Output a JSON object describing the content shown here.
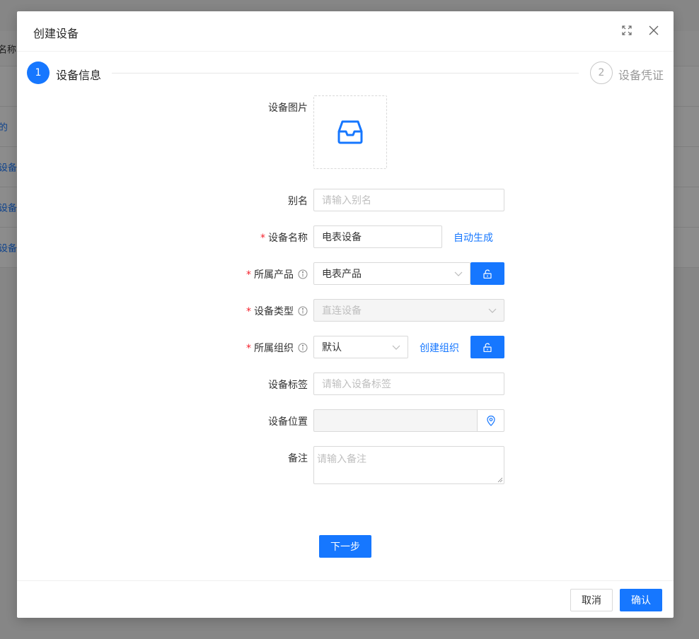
{
  "background": {
    "table_header": "名称",
    "rows": [
      "的",
      "设备",
      "设备",
      "设备"
    ]
  },
  "modal": {
    "title": "创建设备",
    "icons": {
      "expand": "fullscreen-icon",
      "close": "close-icon"
    }
  },
  "steps": [
    {
      "number": "1",
      "label": "设备信息",
      "status": "active"
    },
    {
      "number": "2",
      "label": "设备凭证",
      "status": "wait"
    }
  ],
  "form": {
    "image_label": "设备图片",
    "alias": {
      "label": "别名",
      "placeholder": "请输入别名"
    },
    "device_name": {
      "label": "设备名称",
      "value": "电表设备",
      "auto_link": "自动生成"
    },
    "product": {
      "label": "所属产品",
      "value": "电表产品"
    },
    "device_type": {
      "label": "设备类型",
      "value": "直连设备"
    },
    "org": {
      "label": "所属组织",
      "value": "默认",
      "create_link": "创建组织"
    },
    "tags": {
      "label": "设备标签",
      "placeholder": "请输入设备标签"
    },
    "location": {
      "label": "设备位置"
    },
    "remark": {
      "label": "备注",
      "placeholder": "请输入备注"
    },
    "required_mark": "*"
  },
  "buttons": {
    "next": "下一步",
    "cancel": "取消",
    "confirm": "确认"
  },
  "colors": {
    "primary": "#1677ff",
    "required": "#f5222d"
  }
}
